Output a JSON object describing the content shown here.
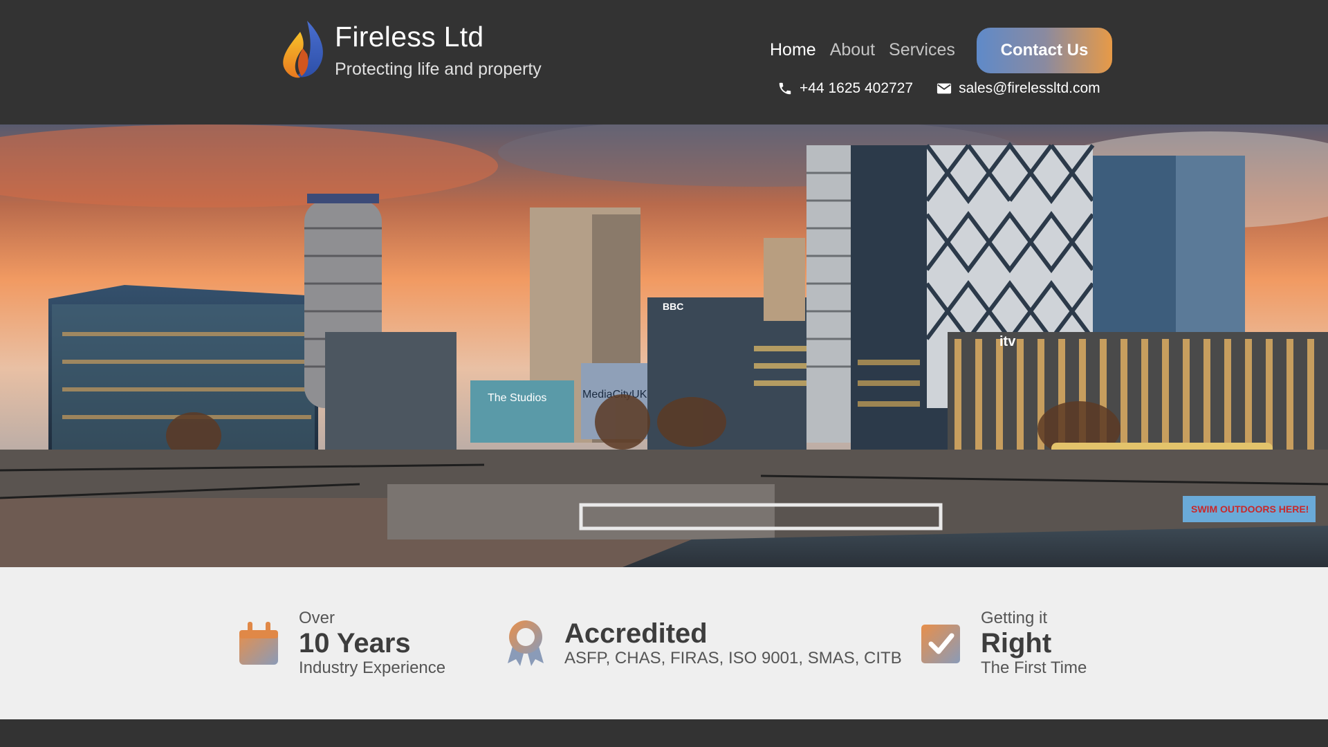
{
  "header": {
    "brand_name": "Fireless Ltd",
    "tagline": "Protecting life and property",
    "nav": [
      {
        "label": "Home",
        "active": true
      },
      {
        "label": "About",
        "active": false
      },
      {
        "label": "Services",
        "active": false
      }
    ],
    "cta_label": "Contact Us",
    "phone": "+44 1625 402727",
    "email": "sales@firelessltd.com"
  },
  "hero": {
    "image_signs": [
      "The Studios",
      "MediaCityUK",
      "BBC",
      "itv",
      "SWIM OUTDOORS HERE!"
    ]
  },
  "features": [
    {
      "icon": "calendar-icon",
      "top": "Over",
      "title": "10 Years",
      "subtitle": "Industry Experience"
    },
    {
      "icon": "award-ribbon-icon",
      "top": "",
      "title": "Accredited",
      "subtitle": "ASFP, CHAS, FIRAS, ISO 9001, SMAS, CITB"
    },
    {
      "icon": "checkbox-check-icon",
      "top": "Getting it",
      "title": "Right",
      "subtitle": "The First Time"
    }
  ],
  "colors": {
    "header_bg": "#333333",
    "features_bg": "#efefef",
    "cta_gradient_start": "#5f8ac9",
    "cta_gradient_end": "#e79a47",
    "icon_gradient_start": "#e88f4a",
    "icon_gradient_end": "#8a9bb8"
  }
}
